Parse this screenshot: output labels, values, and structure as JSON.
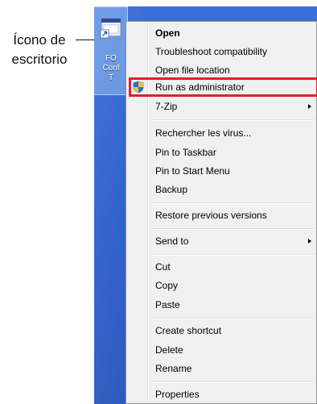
{
  "annotation": {
    "label": "Ícono de\nescritorio"
  },
  "desktop_icon": {
    "icon": "shortcut-icon",
    "label": "FO\nConf\nT"
  },
  "menu": {
    "items": [
      {
        "label": "Open",
        "bold": true
      },
      {
        "label": "Troubleshoot compatibility"
      },
      {
        "label": "Open file location"
      },
      {
        "label": "Run as administrator",
        "icon": "uac-shield-icon",
        "highlighted": true
      },
      {
        "label": "7-Zip",
        "submenu": true
      },
      {
        "label": "Rechercher les virus..."
      },
      {
        "label": "Pin to Taskbar"
      },
      {
        "label": "Pin to Start Menu"
      },
      {
        "label": "Backup"
      },
      {
        "label": "Restore previous versions"
      },
      {
        "label": "Send to",
        "submenu": true
      },
      {
        "label": "Cut"
      },
      {
        "label": "Copy"
      },
      {
        "label": "Paste"
      },
      {
        "label": "Create shortcut"
      },
      {
        "label": "Delete"
      },
      {
        "label": "Rename"
      },
      {
        "label": "Properties"
      }
    ]
  },
  "colors": {
    "highlight_border": "#e11f2b",
    "desktop": "#2f63d1",
    "menu_bg": "#f0f0f0"
  }
}
